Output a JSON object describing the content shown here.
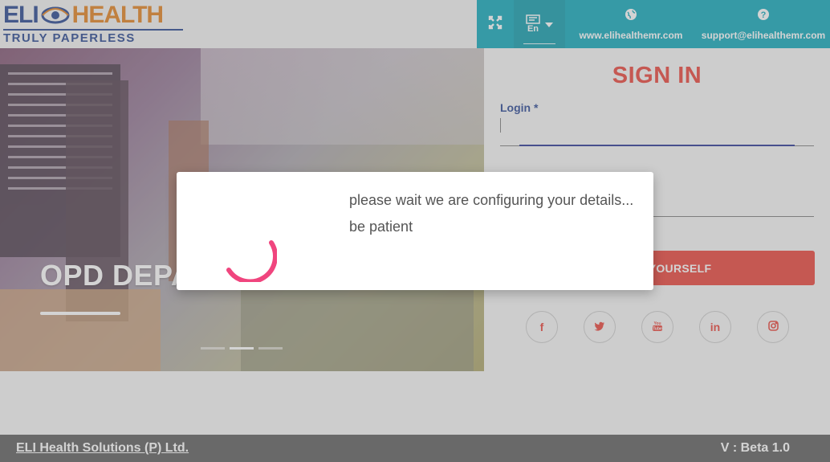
{
  "header": {
    "logo_top_left": "ELI",
    "logo_top_right": "HEALTH",
    "logo_tagline": "TRULY PAPERLESS",
    "website": "www.elihealthemr.com",
    "support": "support@elihealthemr.com",
    "lang_label": "En",
    "colors": {
      "accent": "#03a3b7",
      "brand_blue": "#1a3a8a",
      "brand_orange": "#e07a12"
    }
  },
  "hero": {
    "title": "OPD DEPARTMENT",
    "slides": 3,
    "active_slide": 2
  },
  "signin": {
    "title": "SIGN IN",
    "login_label": "Login *",
    "login_value": "",
    "verify_label": "VERIFY YOURSELF",
    "colors": {
      "primary": "#e8392f",
      "label": "#1e3d8f"
    }
  },
  "socials": [
    {
      "name": "facebook-icon",
      "glyph": "f"
    },
    {
      "name": "twitter-icon",
      "glyph": "t"
    },
    {
      "name": "youtube-icon",
      "glyph": "▶"
    },
    {
      "name": "linkedin-icon",
      "glyph": "in"
    },
    {
      "name": "instagram-icon",
      "glyph": "◎"
    }
  ],
  "dialog": {
    "line1": "please wait we are configuring your details...",
    "line2": "be patient",
    "spinner_color": "#f0457e"
  },
  "footer": {
    "company": "ELI Health Solutions (P) Ltd.",
    "version": "V : Beta 1.0"
  }
}
